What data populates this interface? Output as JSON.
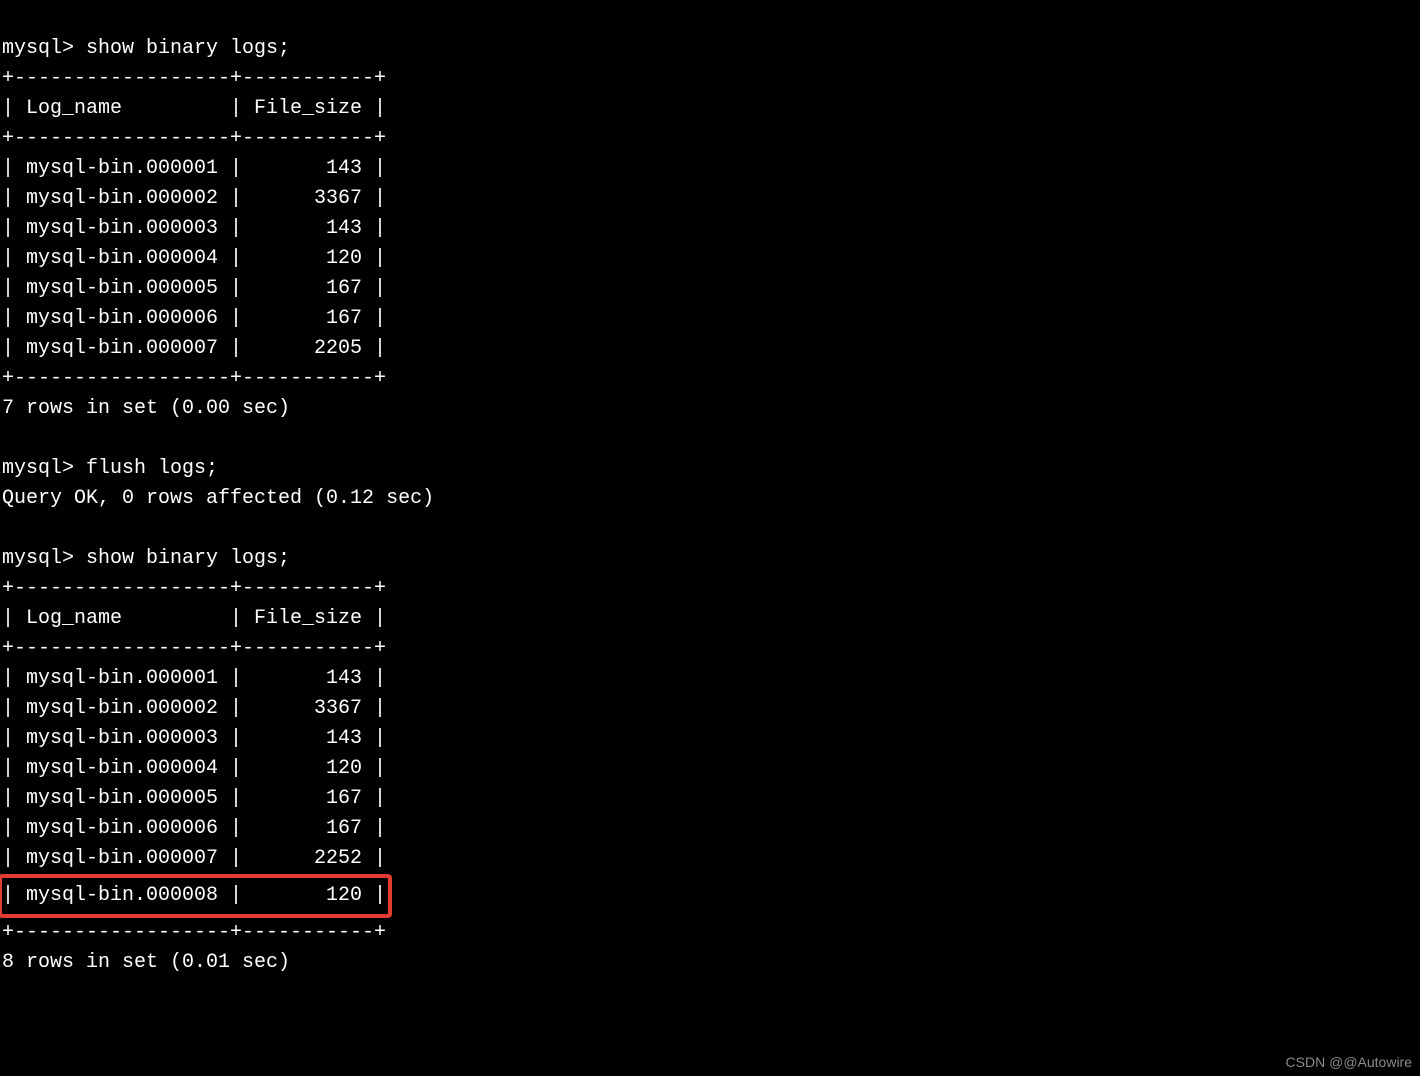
{
  "prompt": "mysql> ",
  "cmd_show_logs": "show binary logs;",
  "cmd_flush_logs": "flush logs;",
  "flush_result": "Query OK, 0 rows affected (0.12 sec)",
  "border": "+------------------+-----------+",
  "header": "| Log_name         | File_size |",
  "table1": {
    "rows": [
      "| mysql-bin.000001 |       143 |",
      "| mysql-bin.000002 |      3367 |",
      "| mysql-bin.000003 |       143 |",
      "| mysql-bin.000004 |       120 |",
      "| mysql-bin.000005 |       167 |",
      "| mysql-bin.000006 |       167 |",
      "| mysql-bin.000007 |      2205 |"
    ],
    "summary": "7 rows in set (0.00 sec)"
  },
  "table2": {
    "rows": [
      "| mysql-bin.000001 |       143 |",
      "| mysql-bin.000002 |      3367 |",
      "| mysql-bin.000003 |       143 |",
      "| mysql-bin.000004 |       120 |",
      "| mysql-bin.000005 |       167 |",
      "| mysql-bin.000006 |       167 |",
      "| mysql-bin.000007 |      2252 |"
    ],
    "highlighted_row": "| mysql-bin.000008 |       120 |",
    "summary": "8 rows in set (0.01 sec)"
  },
  "watermark": "CSDN @@Autowire"
}
